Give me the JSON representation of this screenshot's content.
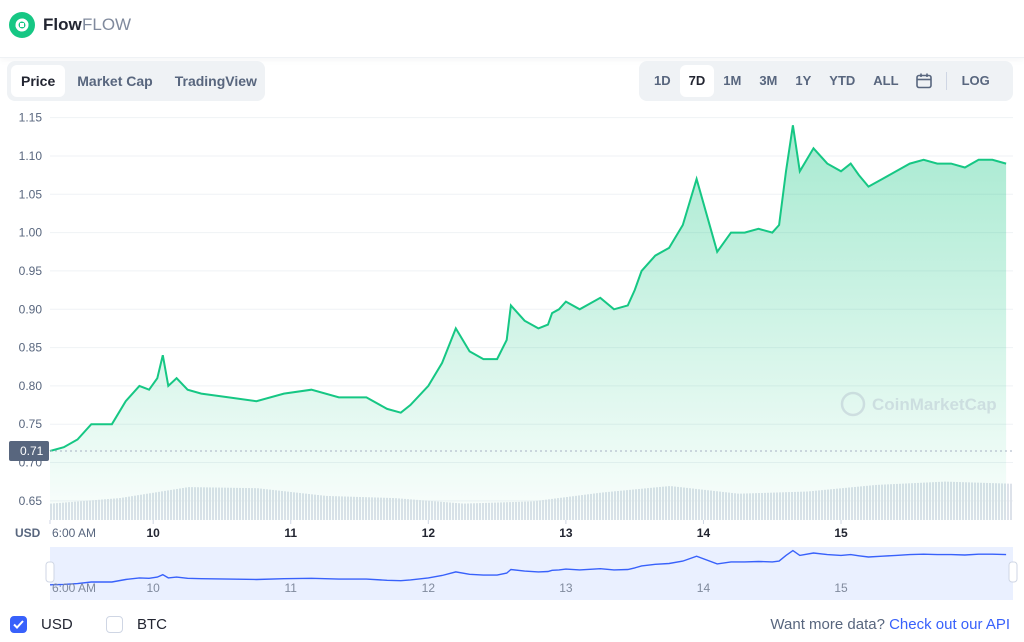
{
  "coin": {
    "name": "Flow",
    "symbol": "FLOW",
    "logo_icon": "flow-logo-icon"
  },
  "tabs": [
    {
      "label": "Price",
      "active": true
    },
    {
      "label": "Market Cap",
      "active": false
    },
    {
      "label": "TradingView",
      "active": false
    }
  ],
  "ranges": [
    {
      "label": "1D",
      "active": false
    },
    {
      "label": "7D",
      "active": true
    },
    {
      "label": "1M",
      "active": false
    },
    {
      "label": "3M",
      "active": false
    },
    {
      "label": "1Y",
      "active": false
    },
    {
      "label": "YTD",
      "active": false
    },
    {
      "label": "ALL",
      "active": false
    }
  ],
  "calendar_icon": "calendar-icon",
  "log_label": "LOG",
  "watermark": "CoinMarketCap",
  "currencies": [
    {
      "label": "USD",
      "checked": true
    },
    {
      "label": "BTC",
      "checked": false
    }
  ],
  "api_text": "Want more data?",
  "api_link": "Check out our API",
  "colors": {
    "accent": "#16c784",
    "nav_line": "#3861fb",
    "text": "#222531",
    "muted": "#58667e"
  },
  "chart_data": {
    "type": "area",
    "currency_label": "USD",
    "current_price_label": "0.71",
    "yticks": [
      0.65,
      0.7,
      0.75,
      0.8,
      0.85,
      0.9,
      0.95,
      1.0,
      1.05,
      1.1,
      1.15
    ],
    "ylim": [
      0.625,
      1.16
    ],
    "xlim": [
      0,
      7
    ],
    "xtick_labels": [
      "6:00 AM",
      "10",
      "11",
      "12",
      "13",
      "14",
      "15"
    ],
    "xtick_positions": [
      0,
      0.75,
      1.75,
      2.75,
      3.75,
      4.75,
      5.75
    ],
    "grid": true,
    "series": [
      {
        "x": [
          0.0,
          0.1,
          0.2,
          0.3,
          0.45,
          0.55,
          0.65,
          0.72,
          0.78,
          0.82,
          0.86,
          0.92,
          1.0,
          1.1,
          1.3,
          1.5,
          1.7,
          1.9,
          2.1,
          2.3,
          2.45,
          2.55,
          2.62,
          2.75,
          2.85,
          2.95,
          3.05,
          3.15,
          3.25,
          3.32,
          3.35,
          3.45,
          3.55,
          3.62,
          3.65,
          3.7,
          3.75,
          3.85,
          4.0,
          4.1,
          4.2,
          4.25,
          4.3,
          4.4,
          4.5,
          4.6,
          4.7,
          4.85,
          4.95,
          5.05,
          5.15,
          5.25,
          5.3,
          5.35,
          5.4,
          5.45,
          5.55,
          5.65,
          5.75,
          5.82,
          5.88,
          5.95,
          6.05,
          6.15,
          6.25,
          6.35,
          6.45,
          6.55,
          6.65,
          6.75,
          6.85,
          6.95
        ],
        "values": [
          0.715,
          0.72,
          0.73,
          0.75,
          0.75,
          0.78,
          0.8,
          0.795,
          0.81,
          0.84,
          0.8,
          0.81,
          0.795,
          0.79,
          0.785,
          0.78,
          0.79,
          0.795,
          0.785,
          0.785,
          0.77,
          0.765,
          0.775,
          0.8,
          0.83,
          0.875,
          0.845,
          0.835,
          0.835,
          0.86,
          0.905,
          0.885,
          0.875,
          0.88,
          0.895,
          0.9,
          0.91,
          0.9,
          0.915,
          0.9,
          0.905,
          0.925,
          0.95,
          0.97,
          0.98,
          1.01,
          1.07,
          0.975,
          1.0,
          1.0,
          1.005,
          1.0,
          1.01,
          1.08,
          1.14,
          1.08,
          1.11,
          1.09,
          1.08,
          1.09,
          1.075,
          1.06,
          1.07,
          1.08,
          1.09,
          1.095,
          1.09,
          1.09,
          1.085,
          1.095,
          1.095,
          1.09
        ]
      }
    ],
    "volume": {
      "x": [
        0.0,
        0.5,
        1.0,
        1.5,
        2.0,
        2.5,
        3.0,
        3.5,
        4.0,
        4.5,
        5.0,
        5.5,
        6.0,
        6.5,
        7.0
      ],
      "values": [
        0.2,
        0.45,
        0.95,
        0.9,
        0.55,
        0.45,
        0.2,
        0.3,
        0.7,
        1.0,
        0.65,
        0.75,
        1.05,
        1.2,
        1.1
      ]
    }
  }
}
